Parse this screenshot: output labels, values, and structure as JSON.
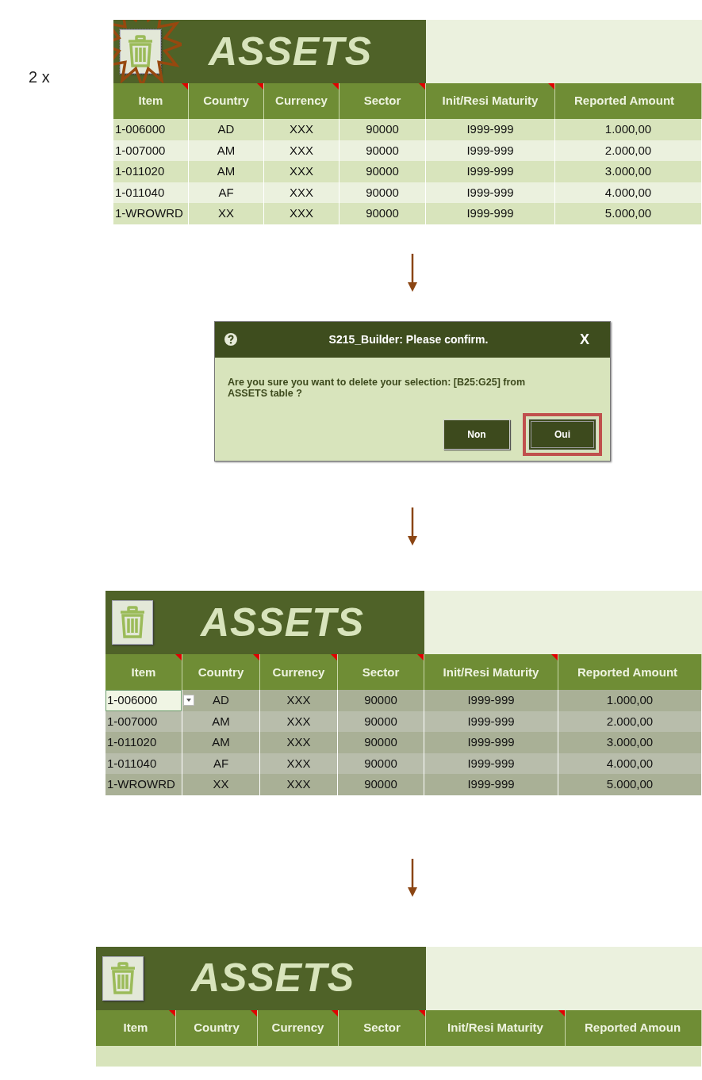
{
  "repeat_label": "2 x",
  "steps": [
    {
      "kind": "table",
      "title": "ASSETS",
      "delete_highlighted": true,
      "columns": [
        {
          "label": "Item",
          "comment": true
        },
        {
          "label": "Country",
          "comment": true
        },
        {
          "label": "Currency",
          "comment": true
        },
        {
          "label": "Sector",
          "comment": true
        },
        {
          "label": "Init/Resi Maturity",
          "comment": true
        },
        {
          "label": "Reported Amount",
          "comment": false
        }
      ],
      "rows": [
        {
          "cells": [
            "1-006000",
            "AD",
            "XXX",
            "90000",
            "I999-999",
            "1.000,00"
          ],
          "selected": false,
          "active": false
        },
        {
          "cells": [
            "1-007000",
            "AM",
            "XXX",
            "90000",
            "I999-999",
            "2.000,00"
          ],
          "selected": false,
          "active": false
        },
        {
          "cells": [
            "1-011020",
            "AM",
            "XXX",
            "90000",
            "I999-999",
            "3.000,00"
          ],
          "selected": false,
          "active": false
        },
        {
          "cells": [
            "1-011040",
            "AF",
            "XXX",
            "90000",
            "I999-999",
            "4.000,00"
          ],
          "selected": false,
          "active": false
        },
        {
          "cells": [
            "1-WROWRD",
            "XX",
            "XXX",
            "90000",
            "I999-999",
            "5.000,00"
          ],
          "selected": false,
          "active": false
        }
      ]
    },
    {
      "kind": "arrow"
    },
    {
      "kind": "dialog",
      "title": "S215_Builder: Please confirm.",
      "close": "X",
      "message": "Are you sure you want to delete your selection: [B25:G25] from ASSETS table ?",
      "buttons": [
        {
          "label": "Non",
          "highlighted": false
        },
        {
          "label": "Oui",
          "highlighted": true
        }
      ]
    },
    {
      "kind": "arrow"
    },
    {
      "kind": "table",
      "title": "ASSETS",
      "delete_highlighted": false,
      "columns": [
        {
          "label": "Item",
          "comment": true
        },
        {
          "label": "Country",
          "comment": true
        },
        {
          "label": "Currency",
          "comment": true
        },
        {
          "label": "Sector",
          "comment": true
        },
        {
          "label": "Init/Resi Maturity",
          "comment": true
        },
        {
          "label": "Reported Amount",
          "comment": false
        }
      ],
      "rows": [
        {
          "cells": [
            "1-006000",
            "AD",
            "XXX",
            "90000",
            "I999-999",
            "1.000,00"
          ],
          "selected": true,
          "active": true
        },
        {
          "cells": [
            "1-007000",
            "AM",
            "XXX",
            "90000",
            "I999-999",
            "2.000,00"
          ],
          "selected": true,
          "active": false
        },
        {
          "cells": [
            "1-011020",
            "AM",
            "XXX",
            "90000",
            "I999-999",
            "3.000,00"
          ],
          "selected": true,
          "active": false
        },
        {
          "cells": [
            "1-011040",
            "AF",
            "XXX",
            "90000",
            "I999-999",
            "4.000,00"
          ],
          "selected": true,
          "active": false
        },
        {
          "cells": [
            "1-WROWRD",
            "XX",
            "XXX",
            "90000",
            "I999-999",
            "5.000,00"
          ],
          "selected": true,
          "active": false
        }
      ]
    },
    {
      "kind": "arrow"
    },
    {
      "kind": "table",
      "title": "ASSETS",
      "delete_highlighted": false,
      "columns": [
        {
          "label": "Item",
          "comment": true
        },
        {
          "label": "Country",
          "comment": true
        },
        {
          "label": "Currency",
          "comment": true
        },
        {
          "label": "Sector",
          "comment": true
        },
        {
          "label": "Init/Resi Maturity",
          "comment": true
        },
        {
          "label": "Reported Amoun",
          "comment": false
        }
      ]
    }
  ]
}
